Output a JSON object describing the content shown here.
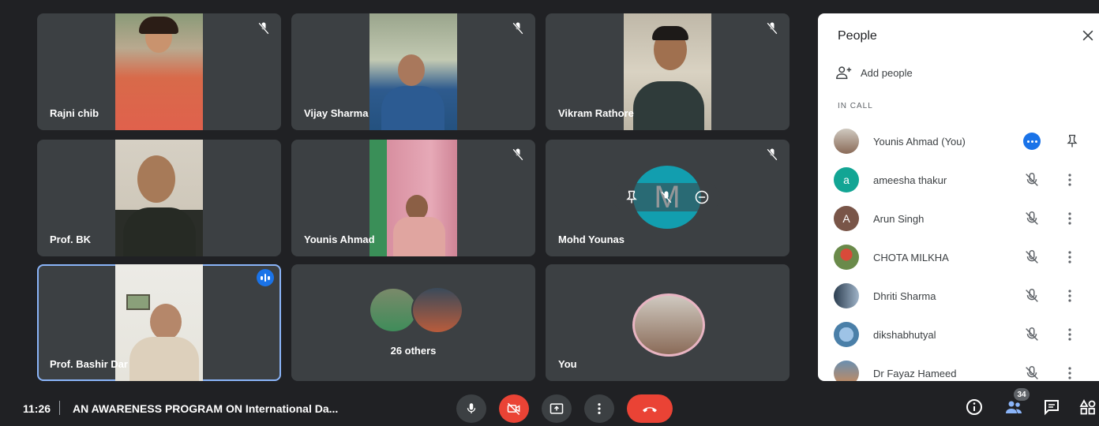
{
  "tiles": [
    {
      "name": "Rajni chib",
      "muted": true
    },
    {
      "name": "Vijay Sharma",
      "muted": true
    },
    {
      "name": "Vikram Rathore",
      "muted": true
    },
    {
      "name": "Prof. BK",
      "muted": false
    },
    {
      "name": "Younis Ahmad",
      "muted": true
    },
    {
      "name": "Mohd Younas",
      "muted": true,
      "avatar_letter": "M"
    },
    {
      "name": "Prof. Bashir Dar",
      "speaking": true
    },
    {
      "name": "26 others"
    },
    {
      "name": "You"
    }
  ],
  "people_panel": {
    "title": "People",
    "add_people": "Add people",
    "section": "IN CALL",
    "participants": [
      {
        "name": "Younis Ahmad (You)",
        "avatar": "photo"
      },
      {
        "name": "ameesha thakur",
        "avatar_letter": "a",
        "avatar_color": "#12a594"
      },
      {
        "name": "Arun Singh",
        "avatar_letter": "A",
        "avatar_color": "#795548"
      },
      {
        "name": "CHOTA MILKHA",
        "avatar": "photo"
      },
      {
        "name": "Dhriti Sharma",
        "avatar": "photo"
      },
      {
        "name": "dikshabhutyal",
        "avatar": "photo"
      },
      {
        "name": "Dr Fayaz Hameed",
        "avatar": "photo"
      }
    ]
  },
  "bottom_bar": {
    "time": "11:26",
    "meeting_title": "AN AWARENESS PROGRAM ON International Da...",
    "participant_count": "34"
  },
  "colors": {
    "accent": "#1a73e8",
    "danger": "#ea4335",
    "tile": "#3c4043",
    "bg": "#202124"
  }
}
